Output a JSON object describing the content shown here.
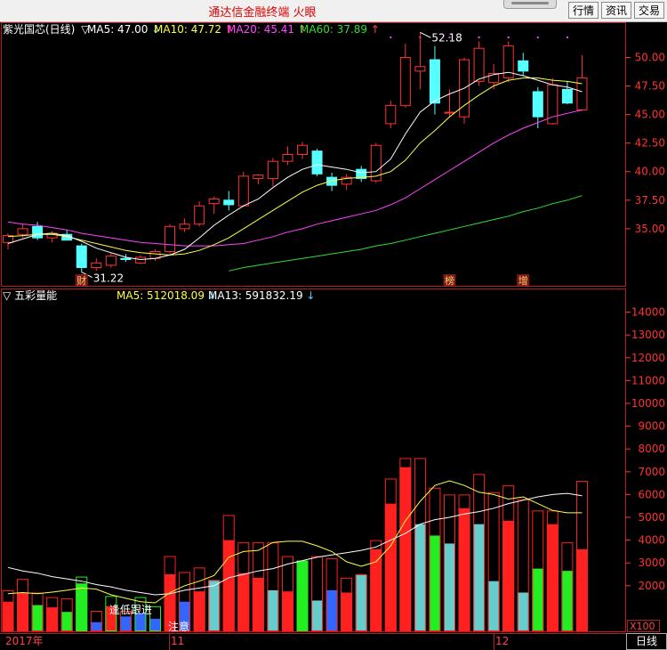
{
  "app": {
    "title": "通达信金融终端  火眼"
  },
  "toolbar": {
    "buttons": [
      "行情",
      "资讯",
      "交易"
    ]
  },
  "price_panel": {
    "stock_title": "紫光国芯(日线)",
    "indicator_marker": "▽",
    "ma_legend": [
      {
        "label": "MA5: 47.00",
        "arrow": "↓",
        "color": "#ffffff"
      },
      {
        "label": "MA10: 47.72",
        "arrow": "↑",
        "color": "#ffff44"
      },
      {
        "label": "MA20: 45.41",
        "arrow": "↑",
        "color": "#ff44ff"
      },
      {
        "label": "MA60: 37.89",
        "arrow": "↑",
        "color": "#33dd33"
      }
    ],
    "high_label": "52.18",
    "low_label": "31.22",
    "event_marks": [
      {
        "label": "财",
        "day": 5
      },
      {
        "label": "榜",
        "day": 30
      },
      {
        "label": "增",
        "day": 35
      }
    ]
  },
  "volume_panel": {
    "title": "五彩量能",
    "indicator_marker": "▽",
    "ma_legend": [
      {
        "label": "MA5: 512018.09",
        "arrow": "↓",
        "color": "#ffff44"
      },
      {
        "label": "MA13: 591832.19",
        "arrow": "↓",
        "color": "#ffffff"
      }
    ],
    "unit_label": "X100",
    "annotations": [
      {
        "label": "逢低跟进",
        "day": 7
      },
      {
        "label": "注意",
        "day": 11
      }
    ]
  },
  "time_axis": {
    "labels": [
      "2017年",
      "11",
      "12"
    ]
  },
  "bottom_tab": "日线",
  "chart_data": [
    {
      "type": "candlestick",
      "title": "紫光国芯(日线)",
      "y_ticks": [
        35.0,
        37.5,
        40.0,
        42.5,
        45.0,
        47.5,
        50.0
      ],
      "ylim": [
        30.0,
        53.0
      ],
      "colors": {
        "up": "#ff3333",
        "down": "#55ffff",
        "ma5": "#ffffff",
        "ma10": "#ffff44",
        "ma20": "#ff44ff",
        "ma60": "#33dd33"
      },
      "candles": [
        {
          "o": 33.8,
          "h": 34.6,
          "l": 33.2,
          "c": 34.4
        },
        {
          "o": 34.5,
          "h": 35.4,
          "l": 34.2,
          "c": 35.0
        },
        {
          "o": 35.2,
          "h": 35.6,
          "l": 34.0,
          "c": 34.2
        },
        {
          "o": 34.2,
          "h": 34.8,
          "l": 33.8,
          "c": 34.6
        },
        {
          "o": 34.5,
          "h": 34.9,
          "l": 34.0,
          "c": 34.0
        },
        {
          "o": 33.5,
          "h": 33.7,
          "l": 31.2,
          "c": 31.6
        },
        {
          "o": 31.6,
          "h": 32.4,
          "l": 31.3,
          "c": 32.0
        },
        {
          "o": 31.8,
          "h": 32.9,
          "l": 31.6,
          "c": 32.6
        },
        {
          "o": 32.4,
          "h": 32.8,
          "l": 32.1,
          "c": 32.3
        },
        {
          "o": 32.0,
          "h": 32.7,
          "l": 31.9,
          "c": 32.5
        },
        {
          "o": 32.4,
          "h": 33.2,
          "l": 32.2,
          "c": 33.0
        },
        {
          "o": 33.0,
          "h": 35.4,
          "l": 32.8,
          "c": 35.2
        },
        {
          "o": 35.0,
          "h": 35.9,
          "l": 34.7,
          "c": 35.4
        },
        {
          "o": 35.4,
          "h": 37.4,
          "l": 35.2,
          "c": 37.0
        },
        {
          "o": 37.2,
          "h": 37.8,
          "l": 36.3,
          "c": 37.6
        },
        {
          "o": 37.5,
          "h": 38.3,
          "l": 36.6,
          "c": 37.1
        },
        {
          "o": 37.0,
          "h": 40.0,
          "l": 36.9,
          "c": 39.6
        },
        {
          "o": 39.4,
          "h": 39.8,
          "l": 38.9,
          "c": 39.7
        },
        {
          "o": 39.4,
          "h": 41.2,
          "l": 38.7,
          "c": 40.9
        },
        {
          "o": 40.9,
          "h": 42.2,
          "l": 40.6,
          "c": 41.5
        },
        {
          "o": 41.5,
          "h": 42.6,
          "l": 41.1,
          "c": 42.3
        },
        {
          "o": 41.8,
          "h": 42.0,
          "l": 39.6,
          "c": 39.8
        },
        {
          "o": 39.5,
          "h": 39.9,
          "l": 38.3,
          "c": 38.8
        },
        {
          "o": 38.9,
          "h": 39.8,
          "l": 38.4,
          "c": 39.5
        },
        {
          "o": 40.2,
          "h": 40.5,
          "l": 39.1,
          "c": 39.4
        },
        {
          "o": 39.2,
          "h": 42.5,
          "l": 39.0,
          "c": 42.3
        },
        {
          "o": 44.2,
          "h": 46.2,
          "l": 43.8,
          "c": 45.8
        },
        {
          "o": 45.8,
          "h": 51.2,
          "l": 45.6,
          "c": 50.0
        },
        {
          "o": 48.8,
          "h": 52.2,
          "l": 47.2,
          "c": 49.2
        },
        {
          "o": 49.8,
          "h": 51.0,
          "l": 45.0,
          "c": 46.0
        },
        {
          "o": 45.2,
          "h": 47.2,
          "l": 44.8,
          "c": 45.2
        },
        {
          "o": 44.8,
          "h": 50.0,
          "l": 44.2,
          "c": 49.8
        },
        {
          "o": 47.9,
          "h": 51.4,
          "l": 47.5,
          "c": 50.8
        },
        {
          "o": 47.8,
          "h": 49.4,
          "l": 47.2,
          "c": 48.6
        },
        {
          "o": 48.2,
          "h": 51.4,
          "l": 47.8,
          "c": 51.0
        },
        {
          "o": 49.7,
          "h": 50.4,
          "l": 48.4,
          "c": 48.8
        },
        {
          "o": 47.0,
          "h": 47.4,
          "l": 43.8,
          "c": 44.8
        },
        {
          "o": 44.2,
          "h": 48.2,
          "l": 44.1,
          "c": 47.6
        },
        {
          "o": 47.2,
          "h": 47.9,
          "l": 45.9,
          "c": 46.0
        },
        {
          "o": 45.4,
          "h": 50.2,
          "l": 45.3,
          "c": 48.2
        }
      ],
      "ma5": [
        33.7,
        34.1,
        34.5,
        34.6,
        34.4,
        33.9,
        33.3,
        32.9,
        32.5,
        32.3,
        32.4,
        32.7,
        33.2,
        34.2,
        35.3,
        36.2,
        37.0,
        37.6,
        38.6,
        39.5,
        40.2,
        40.6,
        40.4,
        40.2,
        39.9,
        40.0,
        41.1,
        43.3,
        45.2,
        46.2,
        46.8,
        47.3,
        48.1,
        48.5,
        48.7,
        48.4,
        48.0,
        47.6,
        47.4,
        47.0
      ],
      "ma10": [
        34.3,
        34.4,
        34.5,
        34.5,
        34.3,
        34.0,
        33.7,
        33.4,
        33.1,
        32.9,
        32.8,
        32.7,
        32.8,
        33.1,
        33.6,
        34.2,
        35.0,
        35.8,
        36.6,
        37.4,
        38.2,
        38.8,
        39.2,
        39.4,
        39.5,
        39.6,
        40.0,
        41.0,
        42.5,
        43.6,
        44.8,
        45.8,
        46.7,
        47.5,
        48.0,
        48.2,
        48.2,
        48.0,
        47.9,
        47.7
      ],
      "ma20": [
        35.6,
        35.4,
        35.3,
        35.1,
        34.9,
        34.6,
        34.4,
        34.2,
        34.0,
        33.8,
        33.7,
        33.6,
        33.5,
        33.5,
        33.5,
        33.6,
        33.7,
        34.0,
        34.3,
        34.7,
        35.0,
        35.4,
        35.7,
        36.0,
        36.3,
        36.6,
        37.1,
        37.7,
        38.5,
        39.3,
        40.1,
        40.9,
        41.7,
        42.5,
        43.2,
        43.8,
        44.3,
        44.8,
        45.1,
        45.4
      ],
      "ma60": [
        null,
        null,
        null,
        null,
        null,
        null,
        null,
        null,
        null,
        null,
        null,
        null,
        null,
        null,
        null,
        31.3,
        31.6,
        31.8,
        32.0,
        32.2,
        32.4,
        32.6,
        32.8,
        33.0,
        33.2,
        33.5,
        33.7,
        34.0,
        34.3,
        34.6,
        34.9,
        35.2,
        35.5,
        35.8,
        36.1,
        36.5,
        36.8,
        37.2,
        37.5,
        37.9
      ]
    },
    {
      "type": "bar",
      "title": "五彩量能",
      "y_ticks": [
        2000,
        3000,
        4000,
        5000,
        6000,
        7000,
        8000,
        9000,
        10000,
        11000,
        12000,
        13000,
        14000
      ],
      "ylim": [
        0,
        15000
      ],
      "unit": "X100",
      "colors": {
        "red": "#ff2020",
        "green": "#22ee22",
        "blue": "#3366ff",
        "cyan": "#66cccc",
        "outline": "#ff2020",
        "outline_green": "#22ee22",
        "ma5": "#ffff44",
        "ma13": "#ffffff"
      },
      "bars": [
        {
          "v": 1800,
          "solid": 1300,
          "fill": "red",
          "outline": "red"
        },
        {
          "v": 2300,
          "solid": 1700,
          "fill": "red",
          "outline": "red"
        },
        {
          "v": 1700,
          "solid": 1150,
          "fill": "green",
          "outline": "red"
        },
        {
          "v": 1500,
          "solid": 1050,
          "fill": "red",
          "outline": "red"
        },
        {
          "v": 1450,
          "solid": 850,
          "fill": "green",
          "outline": "red"
        },
        {
          "v": 2400,
          "solid": 2100,
          "fill": "green",
          "outline": "green"
        },
        {
          "v": 900,
          "solid": 400,
          "fill": "blue",
          "outline": "red"
        },
        {
          "v": 1550,
          "solid": 1100,
          "fill": "red",
          "outline": "green"
        },
        {
          "v": 900,
          "solid": 650,
          "fill": "blue",
          "outline": "red"
        },
        {
          "v": 1500,
          "solid": 800,
          "fill": "blue",
          "outline": "green"
        },
        {
          "v": 1100,
          "solid": 550,
          "fill": "blue",
          "outline": "green"
        },
        {
          "v": 3300,
          "solid": 2500,
          "fill": "red",
          "outline": "red"
        },
        {
          "v": 2600,
          "solid": 1300,
          "fill": "blue",
          "outline": "red"
        },
        {
          "v": 2800,
          "solid": 1750,
          "fill": "red",
          "outline": "red"
        },
        {
          "v": 2250,
          "solid": 2250,
          "fill": "cyan",
          "outline": "red"
        },
        {
          "v": 5100,
          "solid": 4000,
          "fill": "red",
          "outline": "red"
        },
        {
          "v": 3900,
          "solid": 2550,
          "fill": "red",
          "outline": "red"
        },
        {
          "v": 3900,
          "solid": 2350,
          "fill": "red",
          "outline": "red"
        },
        {
          "v": 3900,
          "solid": 1800,
          "fill": "cyan",
          "outline": "red"
        },
        {
          "v": 3300,
          "solid": 1750,
          "fill": "red",
          "outline": "red"
        },
        {
          "v": 3100,
          "solid": 3100,
          "fill": "green",
          "outline": "green"
        },
        {
          "v": 3300,
          "solid": 1350,
          "fill": "cyan",
          "outline": "red"
        },
        {
          "v": 3200,
          "solid": 1800,
          "fill": "blue",
          "outline": "red"
        },
        {
          "v": 2350,
          "solid": 1700,
          "fill": "red",
          "outline": "red"
        },
        {
          "v": 2500,
          "solid": 2500,
          "fill": "cyan",
          "outline": "red"
        },
        {
          "v": 4000,
          "solid": 3600,
          "fill": "red",
          "outline": "red"
        },
        {
          "v": 6700,
          "solid": 5600,
          "fill": "red",
          "outline": "red"
        },
        {
          "v": 7600,
          "solid": 7200,
          "fill": "red",
          "outline": "red"
        },
        {
          "v": 7600,
          "solid": 4700,
          "fill": "cyan",
          "outline": "red"
        },
        {
          "v": 6300,
          "solid": 4200,
          "fill": "green",
          "outline": "red"
        },
        {
          "v": 6000,
          "solid": 3850,
          "fill": "cyan",
          "outline": "red"
        },
        {
          "v": 6000,
          "solid": 5400,
          "fill": "red",
          "outline": "red"
        },
        {
          "v": 6900,
          "solid": 4700,
          "fill": "cyan",
          "outline": "red"
        },
        {
          "v": 6100,
          "solid": 2200,
          "fill": "cyan",
          "outline": "red"
        },
        {
          "v": 6400,
          "solid": 4850,
          "fill": "red",
          "outline": "red"
        },
        {
          "v": 5800,
          "solid": 1700,
          "fill": "cyan",
          "outline": "red"
        },
        {
          "v": 5300,
          "solid": 2750,
          "fill": "green",
          "outline": "red"
        },
        {
          "v": 5300,
          "solid": 4700,
          "fill": "red",
          "outline": "red"
        },
        {
          "v": 3900,
          "solid": 2650,
          "fill": "green",
          "outline": "red"
        },
        {
          "v": 6600,
          "solid": 3600,
          "fill": "red",
          "outline": "red"
        }
      ],
      "ma5": [
        1650,
        1700,
        1650,
        1720,
        1800,
        1900,
        1850,
        1600,
        1450,
        1300,
        1250,
        1700,
        2000,
        2200,
        2450,
        3250,
        3500,
        3550,
        3900,
        3950,
        3950,
        3750,
        3500,
        3050,
        2850,
        3050,
        3750,
        4850,
        5700,
        6400,
        6600,
        6400,
        6100,
        6000,
        5800,
        5900,
        5600,
        5300,
        5200,
        5200
      ],
      "ma13": [
        2800,
        2650,
        2550,
        2400,
        2300,
        2200,
        2050,
        1950,
        1800,
        1700,
        1600,
        1650,
        1800,
        1900,
        2000,
        2350,
        2500,
        2650,
        2750,
        2950,
        3100,
        3250,
        3350,
        3450,
        3550,
        3700,
        4000,
        4300,
        4700,
        4900,
        5000,
        5150,
        5250,
        5400,
        5600,
        5750,
        5900,
        6000,
        6050,
        5950
      ]
    }
  ]
}
